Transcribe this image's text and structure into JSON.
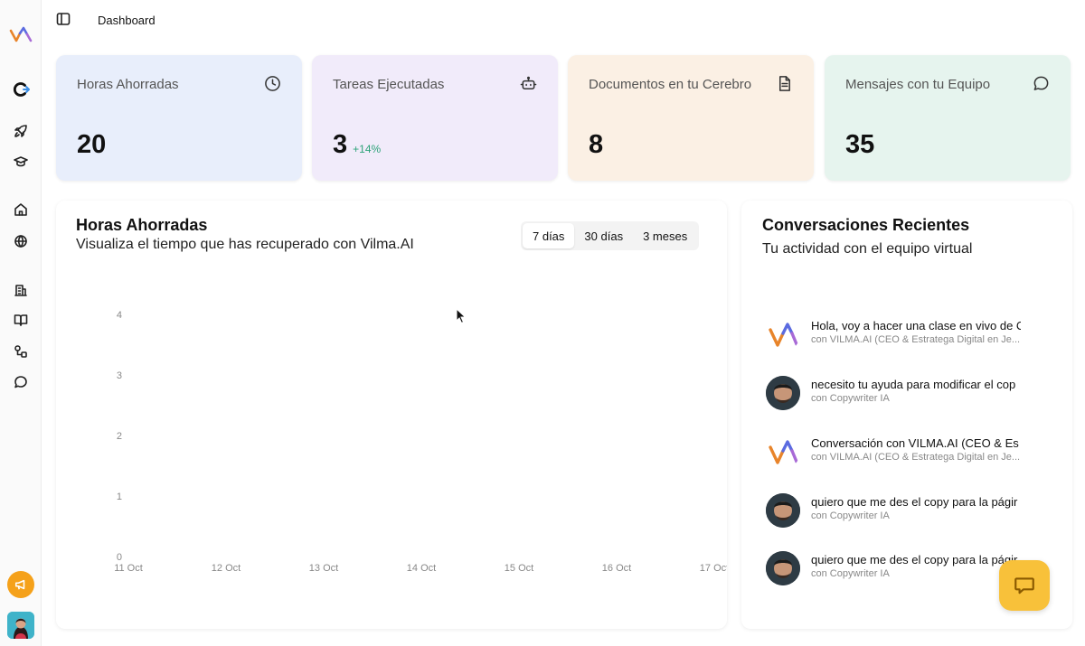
{
  "header": {
    "breadcrumb": "Dashboard"
  },
  "sidebar": {
    "icons": [
      "logo-icon",
      "c-arrow-icon",
      "rocket-icon",
      "graduation-cap-icon",
      "home-icon",
      "globe-icon",
      "building-icon",
      "book-icon",
      "nodes-icon",
      "chat-icon",
      "megaphone-icon",
      "user-avatar"
    ]
  },
  "stats": [
    {
      "label": "Horas Ahorradas",
      "value": "20",
      "delta": "",
      "icon": "clock-icon",
      "bg": "#e8eefb"
    },
    {
      "label": "Tareas Ejecutadas",
      "value": "3",
      "delta": "+14%",
      "icon": "bot-icon",
      "bg": "#f1ebfa"
    },
    {
      "label": "Documentos en tu Cerebro",
      "value": "8",
      "delta": "",
      "icon": "document-icon",
      "bg": "#fbf0e4"
    },
    {
      "label": "Mensajes con tu Equipo",
      "value": "35",
      "delta": "",
      "icon": "message-icon",
      "bg": "#e6f4ee"
    }
  ],
  "chart_panel": {
    "title": "Horas Ahorradas",
    "subtitle": "Visualiza el tiempo que has recuperado con Vilma.AI",
    "ranges": [
      "7 días",
      "30 días",
      "3 meses"
    ],
    "active_range": "7 días"
  },
  "chart_data": {
    "type": "area",
    "x": [
      "11 Oct",
      "12 Oct",
      "13 Oct",
      "14 Oct",
      "15 Oct",
      "16 Oct",
      "17 Oct"
    ],
    "series": [],
    "ylim": [
      0,
      4
    ],
    "yticks": [
      "0",
      "1",
      "2",
      "3",
      "4"
    ],
    "grid": false
  },
  "conversations_panel": {
    "title": "Conversaciones Recientes",
    "subtitle": "Tu actividad con el equipo virtual",
    "items": [
      {
        "title": "Hola, voy a hacer una clase en vivo de C",
        "subtitle": "con VILMA.AI (CEO & Estratega Digital en Je...",
        "avatar": "vilma-logo"
      },
      {
        "title": "necesito tu ayuda para modificar el cop",
        "subtitle": "con Copywriter IA",
        "avatar": "copywriter-photo"
      },
      {
        "title": "Conversación con VILMA.AI (CEO & Es",
        "subtitle": "con VILMA.AI (CEO & Estratega Digital en Je...",
        "avatar": "vilma-logo"
      },
      {
        "title": "quiero que me des el copy para la págir",
        "subtitle": "con Copywriter IA",
        "avatar": "copywriter-photo"
      },
      {
        "title": "quiero que me des el copy para la págir",
        "subtitle": "con Copywriter IA",
        "avatar": "copywriter-photo"
      }
    ]
  },
  "colors": {
    "accent_yellow": "#f8c13a",
    "positive": "#2fa37a",
    "megaphone": "#f5a11a"
  }
}
